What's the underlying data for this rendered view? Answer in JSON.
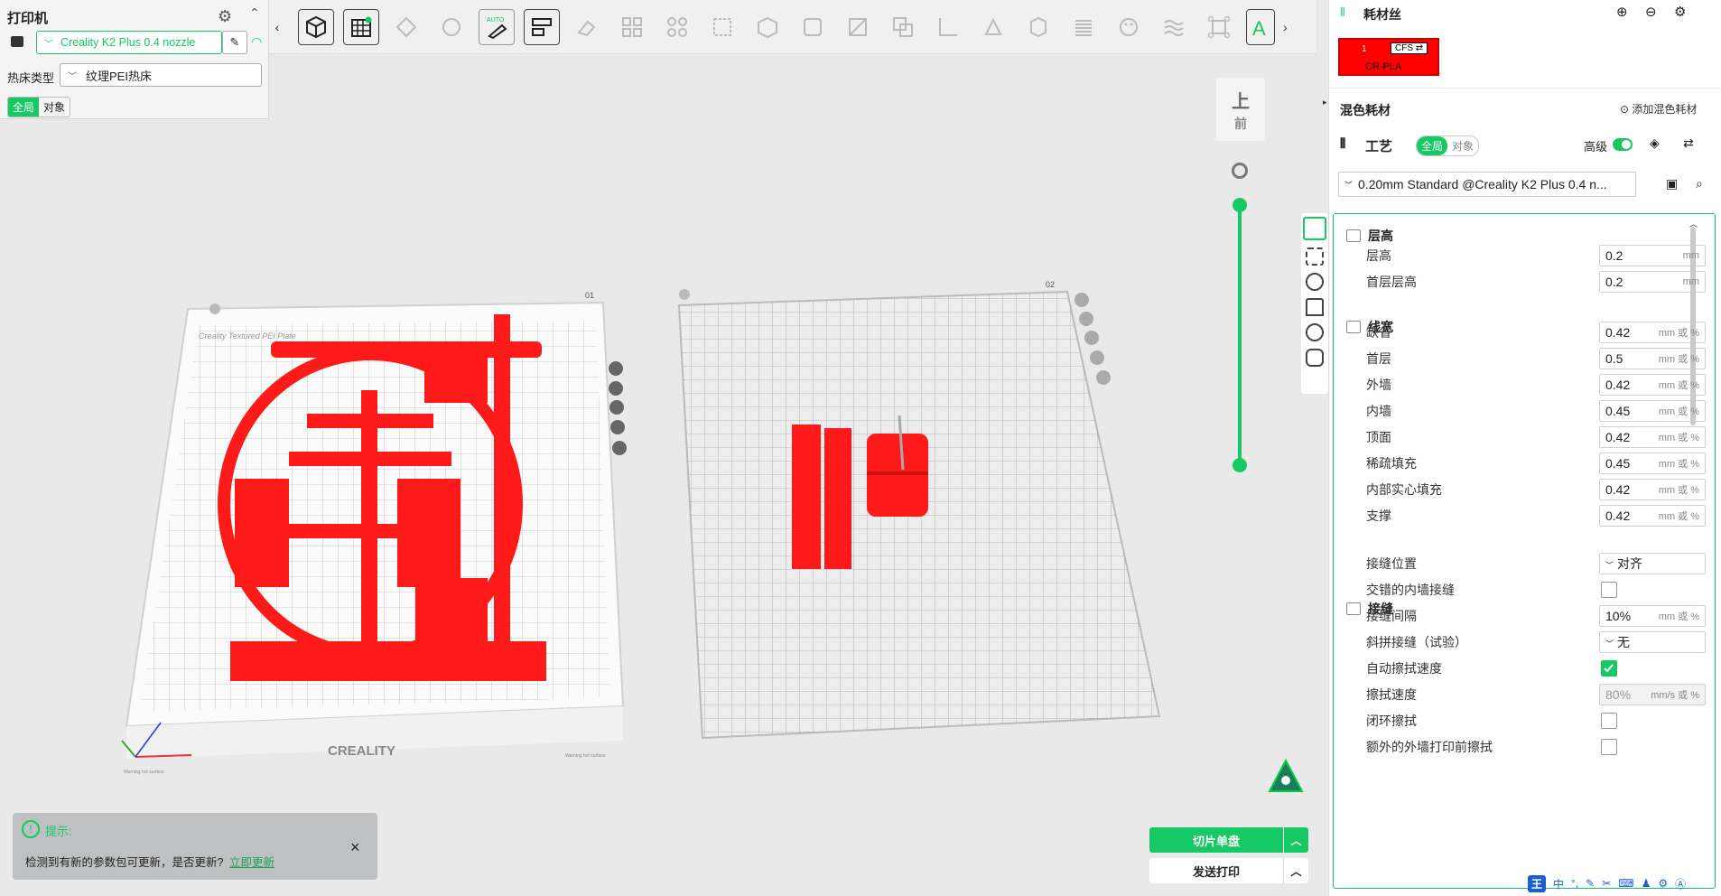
{
  "printer_panel": {
    "title": "打印机",
    "printer_name": "Creality K2 Plus 0.4 nozzle",
    "bed_label": "热床类型",
    "bed_value": "纹理PEI热床",
    "scope_global": "全局",
    "scope_object": "对象"
  },
  "viewport": {
    "plate1_number": "01",
    "plate2_number": "02",
    "plate1_brand": "Creality Textured PEI Plate",
    "plate1_logo": "CREALITY",
    "warn_text": "Warning hot surface",
    "view_top": "上",
    "view_front": "前"
  },
  "notice": {
    "title": "提示:",
    "text": "检测到有新的参数包可更新，是否更新?",
    "link": "立即更新",
    "close": "×"
  },
  "actions": {
    "slice": "切片单盘",
    "send": "发送打印"
  },
  "filament": {
    "title": "耗材丝",
    "slot_number": "1",
    "cfs_label": "CFS ⇄",
    "material": "CR-PLA",
    "color": "#ff0000",
    "mixed_title": "混色耗材",
    "add_mixed": "添加混色耗材"
  },
  "process": {
    "title": "工艺",
    "scope_global": "全局",
    "scope_object": "对象",
    "advanced_label": "高级",
    "profile": "0.20mm Standard @Creality K2 Plus 0.4 n..."
  },
  "sections": {
    "layer_height": "层高",
    "line_width": "线宽",
    "seam": "接缝"
  },
  "settings": [
    {
      "label": "层高",
      "value": "0.2",
      "unit": "mm",
      "type": "input"
    },
    {
      "label": "首层层高",
      "value": "0.2",
      "unit": "mm",
      "type": "input"
    },
    {
      "label": "缺省",
      "value": "0.42",
      "unit": "mm 或 %",
      "type": "input"
    },
    {
      "label": "首层",
      "value": "0.5",
      "unit": "mm 或 %",
      "type": "input"
    },
    {
      "label": "外墙",
      "value": "0.42",
      "unit": "mm 或 %",
      "type": "input"
    },
    {
      "label": "内墙",
      "value": "0.45",
      "unit": "mm 或 %",
      "type": "input"
    },
    {
      "label": "顶面",
      "value": "0.42",
      "unit": "mm 或 %",
      "type": "input"
    },
    {
      "label": "稀疏填充",
      "value": "0.45",
      "unit": "mm 或 %",
      "type": "input"
    },
    {
      "label": "内部实心填充",
      "value": "0.42",
      "unit": "mm 或 %",
      "type": "input"
    },
    {
      "label": "支撑",
      "value": "0.42",
      "unit": "mm 或 %",
      "type": "input"
    },
    {
      "label": "接缝位置",
      "value": "对齐",
      "type": "select"
    },
    {
      "label": "交错的内墙接缝",
      "type": "checkbox",
      "checked": false
    },
    {
      "label": "接缝间隔",
      "value": "10%",
      "unit": "mm 或 %",
      "type": "input"
    },
    {
      "label": "斜拼接缝（试验）",
      "value": "无",
      "type": "select"
    },
    {
      "label": "自动擦拭速度",
      "type": "checkbox",
      "checked": true
    },
    {
      "label": "擦拭速度",
      "value": "80%",
      "unit": "mm/s 或 %",
      "type": "input-disabled"
    },
    {
      "label": "闭环擦拭",
      "type": "checkbox",
      "checked": false
    },
    {
      "label": "额外的外墙打印前擦拭",
      "type": "checkbox",
      "checked": false
    }
  ],
  "taskbar": {
    "ime": "中"
  }
}
